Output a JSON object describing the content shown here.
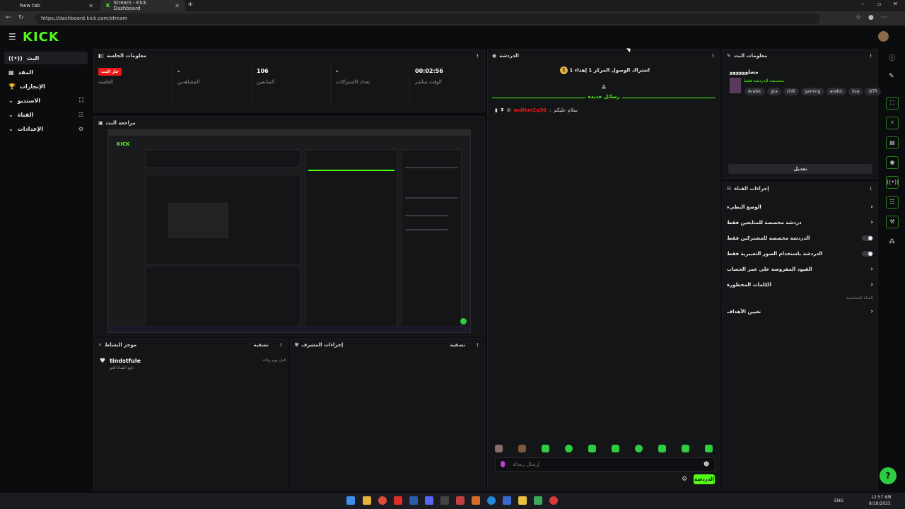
{
  "browser": {
    "tabs": [
      {
        "title": "New tab"
      },
      {
        "title": "Stream - Kick Dashboard"
      }
    ],
    "new_tab": "+",
    "url": "https://dashboard.kick.com/stream"
  },
  "app": {
    "logo": "KICK",
    "nav": [
      {
        "label": "البث",
        "icon": "live-icon"
      },
      {
        "label": "المقد",
        "icon": "grid-icon"
      },
      {
        "label": "الإنجازات",
        "icon": "trophy-icon"
      },
      {
        "label": "الاستديو",
        "icon": "studio-icon"
      },
      {
        "label": "القناة",
        "icon": "channel-icon"
      },
      {
        "label": "الإعدادات",
        "icon": "gear-icon"
      }
    ]
  },
  "session": {
    "title": "معلومات الجلسة",
    "badge": "جار البث",
    "stats": [
      {
        "value": "",
        "label": "الجلسة"
      },
      {
        "value": "-",
        "label": "المشاهدين"
      },
      {
        "value": "106",
        "label": "المتابعين"
      },
      {
        "value": "-",
        "label": "تعداد الاشتراكات"
      },
      {
        "value": "00:02:56",
        "label": "الوقت مباشر"
      }
    ]
  },
  "preview": {
    "title": "مراجعة البث",
    "logo": "KICK"
  },
  "activity": {
    "title": "موجز النشاط",
    "filter": "تصفية",
    "item_user": "tindstfule",
    "item_action": "تابع القناة للتو",
    "item_time": "قبل يوم واحد"
  },
  "mod": {
    "title": "إجراءات المشرف",
    "filter": "تصفية"
  },
  "chat": {
    "title": "الدردشة",
    "sub_line": "1 اشتراك الوصول المركز 1 إهداء",
    "sub_rank": "1",
    "new_messages": "رسائل جديدة",
    "message_user": "mdlkm2q30",
    "message_text": "سلام عليكم",
    "input_placeholder": "إرسال رسالة",
    "send_button": "الدردشة"
  },
  "stream_info": {
    "title": "معلومات البث",
    "stream_title": "مسلوووووو",
    "category": "مخصصة للدردشة فقط",
    "tags": [
      "Arabic",
      "gta",
      "chill",
      "gaming",
      "arabic",
      "ksa",
      "QTR"
    ],
    "edit_button": "تعديل"
  },
  "channel_actions": {
    "title": "إجراءات القناة",
    "rows": [
      {
        "label": "الوضع البطيء",
        "type": "chevron"
      },
      {
        "label": "دردشة مخصصة للمتابعين فقط",
        "type": "chevron"
      },
      {
        "label": "الدردشة مخصصة للمشتركين فقط",
        "type": "toggle"
      },
      {
        "label": "الدردشة باستخدام الصور التعبيرية فقط",
        "type": "toggle"
      },
      {
        "label": "القيود المفروضة على عمر الحساب",
        "type": "chevron"
      },
      {
        "label": "الكلمات المحظورة",
        "type": "chevron"
      }
    ],
    "section_label": "القناة الشخصية",
    "targets_row": "تعيين الأهداف"
  },
  "taskbar": {
    "lang": "ENG",
    "time": "12:57 AM",
    "date": "8/18/2025"
  },
  "colors": {
    "accent": "#53fc18",
    "live": "#e91916",
    "panel": "#141517",
    "background": "#0b0c0e"
  }
}
